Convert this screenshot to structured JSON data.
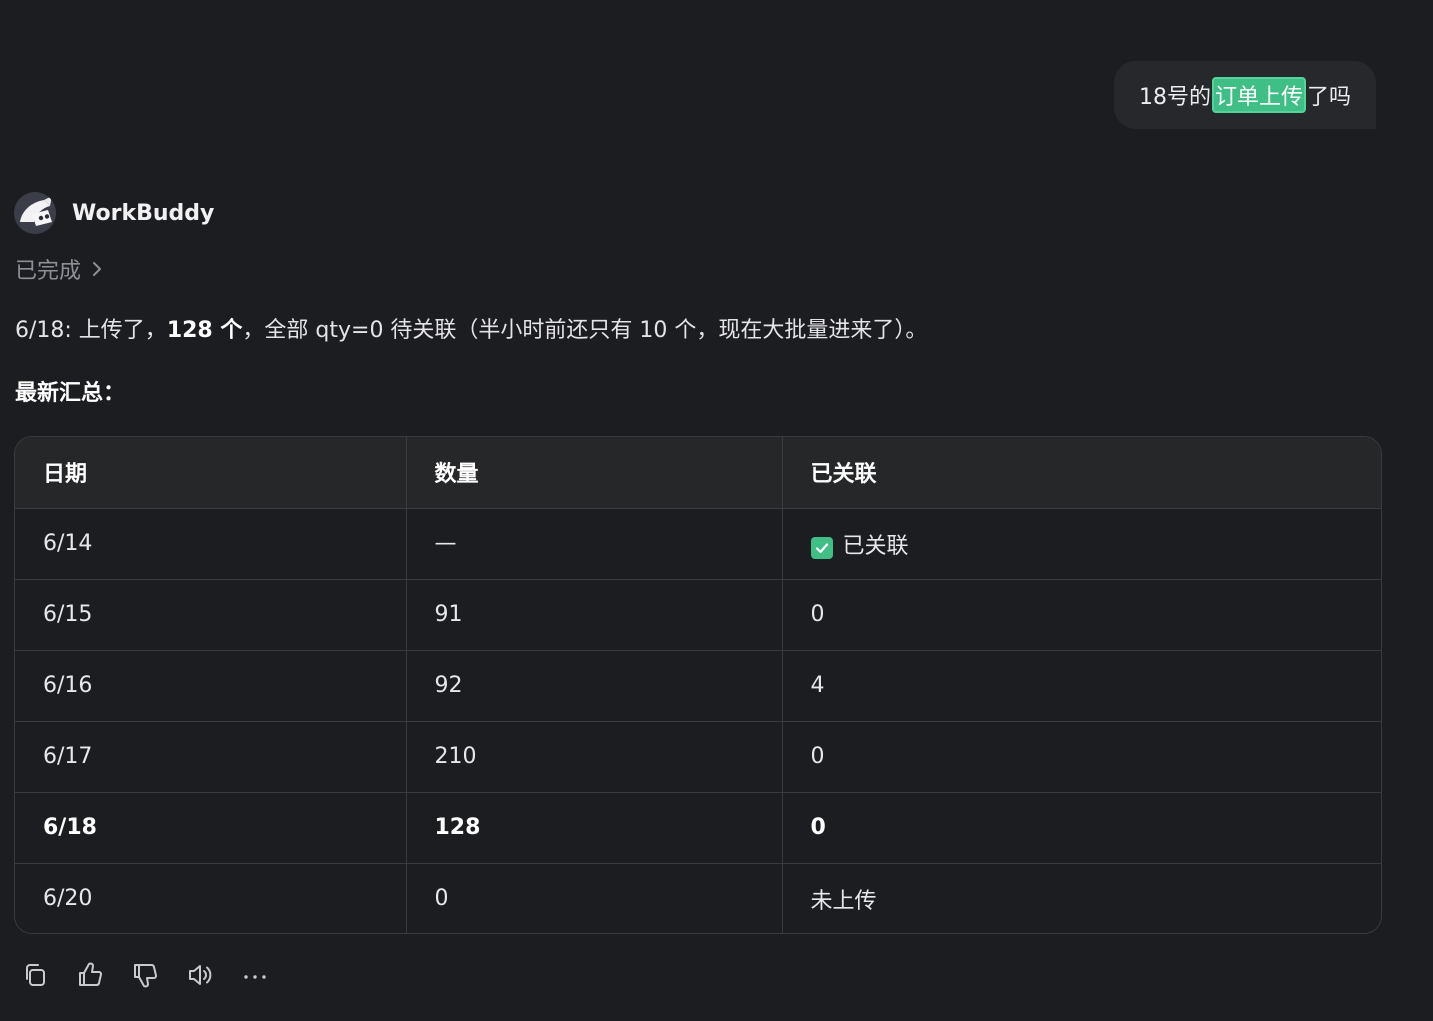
{
  "user_message": {
    "prefix": "18号的",
    "highlight": "订单上传",
    "suffix": "了吗"
  },
  "assistant": {
    "name": "WorkBuddy",
    "status": "已完成"
  },
  "message": {
    "part1": "6/18: 上传了，",
    "bold": "128 个",
    "part2": "，全部 qty=0 待关联（半小时前还只有 10 个，现在大批量进来了）。"
  },
  "summary_title": "最新汇总：",
  "table": {
    "headers": [
      "日期",
      "数量",
      "已关联"
    ],
    "rows": [
      [
        "6/14",
        "—",
        "已关联"
      ],
      [
        "6/15",
        "91",
        "0"
      ],
      [
        "6/16",
        "92",
        "4"
      ],
      [
        "6/17",
        "210",
        "0"
      ],
      [
        "6/18",
        "128",
        "0"
      ],
      [
        "6/20",
        "0",
        "未上传"
      ]
    ]
  },
  "actions": [
    "copy-icon",
    "thumbs-up-icon",
    "thumbs-down-icon",
    "speaker-icon",
    "more-icon"
  ],
  "colors": {
    "background": "#1c1d21",
    "accent": "#3fbf86"
  }
}
